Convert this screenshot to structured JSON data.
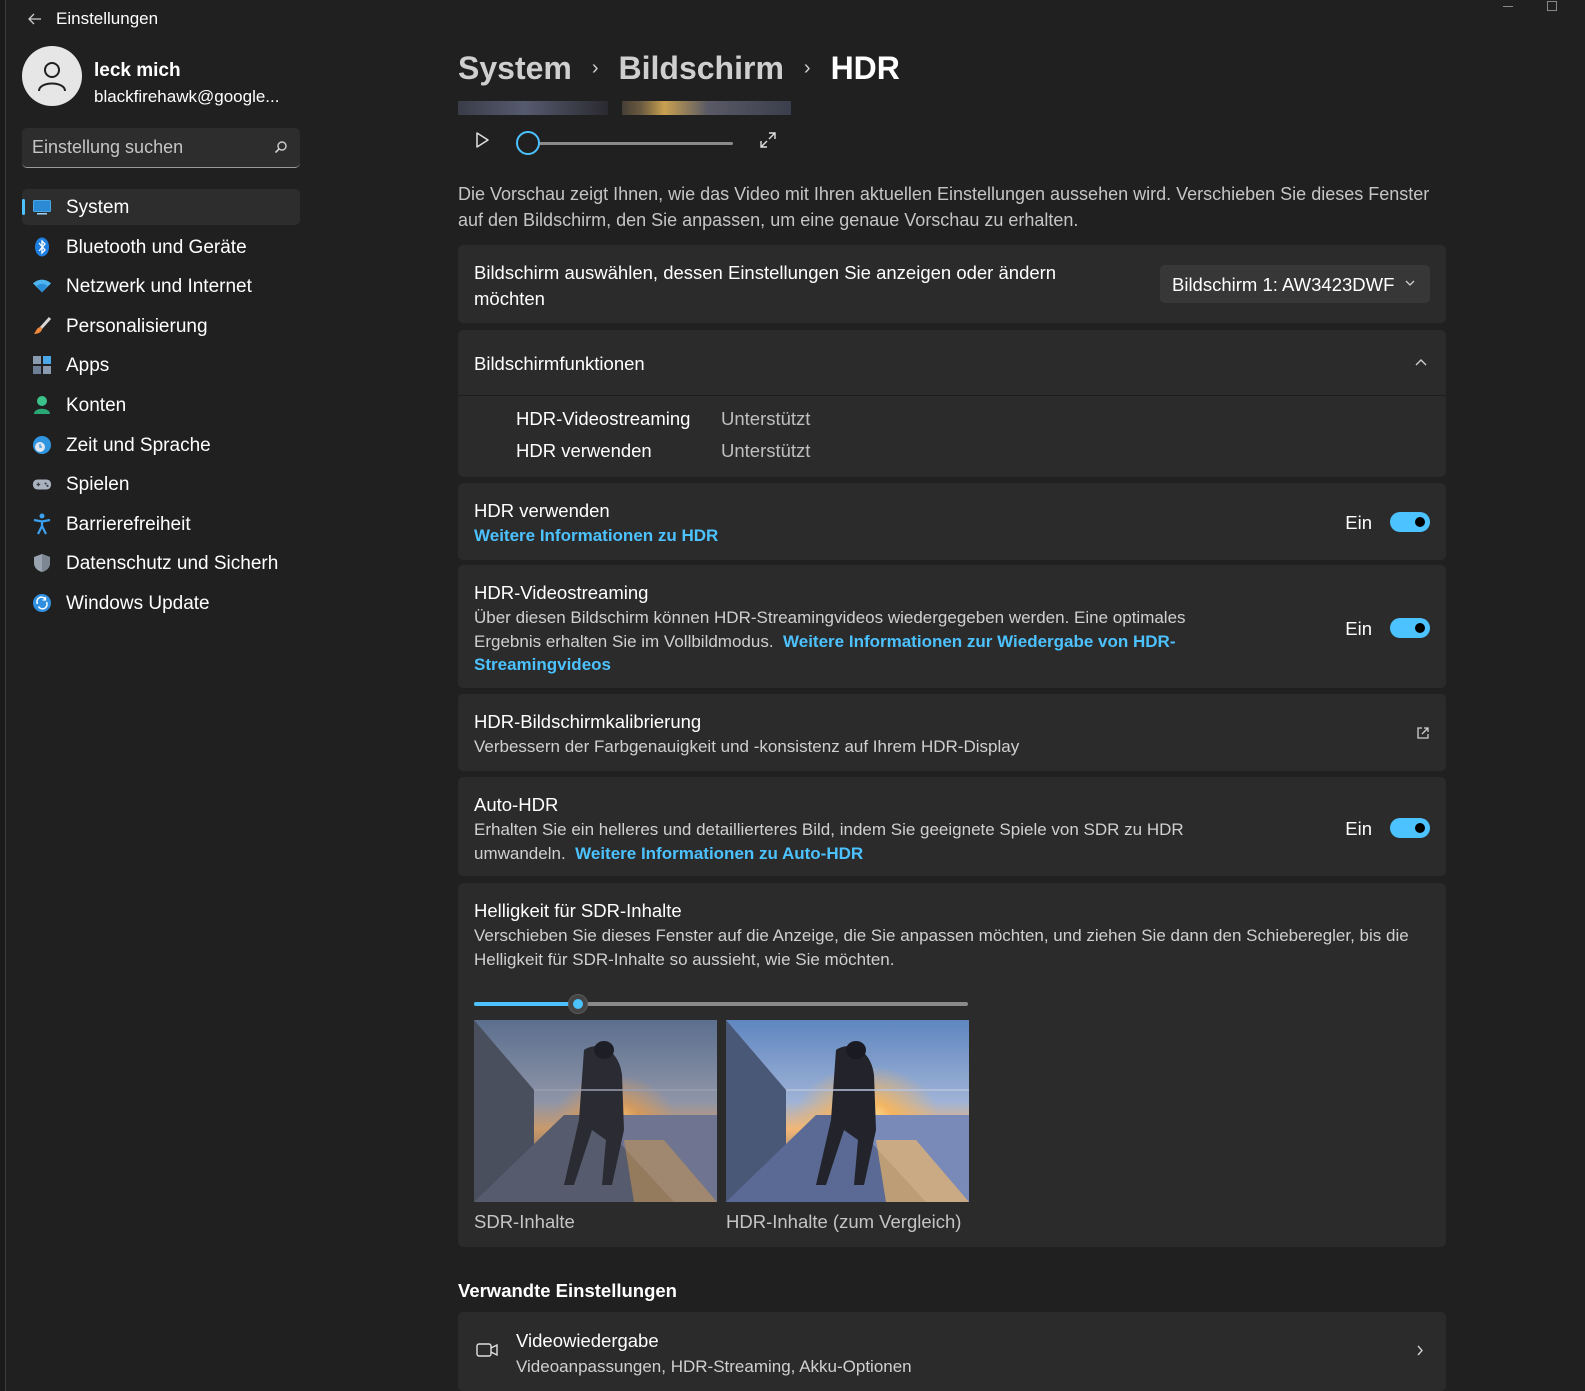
{
  "window": {
    "title": "Einstellungen"
  },
  "profile": {
    "name": "leck mich",
    "email": "blackfirehawk@google..."
  },
  "search": {
    "placeholder": "Einstellung suchen"
  },
  "nav": {
    "items": [
      {
        "label": "System",
        "icon": "system-icon",
        "active": true
      },
      {
        "label": "Bluetooth und Geräte",
        "icon": "bluetooth-icon"
      },
      {
        "label": "Netzwerk und Internet",
        "icon": "wifi-icon"
      },
      {
        "label": "Personalisierung",
        "icon": "brush-icon"
      },
      {
        "label": "Apps",
        "icon": "apps-icon"
      },
      {
        "label": "Konten",
        "icon": "account-icon"
      },
      {
        "label": "Zeit und Sprache",
        "icon": "globe-clock-icon"
      },
      {
        "label": "Spielen",
        "icon": "gamepad-icon"
      },
      {
        "label": "Barrierefreiheit",
        "icon": "accessibility-icon"
      },
      {
        "label": "Datenschutz und Sicherheit",
        "icon": "shield-icon"
      },
      {
        "label": "Windows Update",
        "icon": "update-icon"
      }
    ]
  },
  "breadcrumb": {
    "items": [
      "System",
      "Bildschirm"
    ],
    "current": "HDR"
  },
  "preview": {
    "description": "Die Vorschau zeigt Ihnen, wie das Video mit Ihren aktuellen Einstellungen aussehen wird. Verschieben Sie dieses Fenster auf den Bildschirm, den Sie anpassen, um eine genaue Vorschau zu erhalten."
  },
  "display_select": {
    "label": "Bildschirm auswählen, dessen Einstellungen Sie anzeigen oder ändern möchten",
    "value": "Bildschirm 1: AW3423DWF"
  },
  "features": {
    "title": "Bildschirmfunktionen",
    "rows": [
      {
        "name": "HDR-Videostreaming",
        "value": "Unterstützt"
      },
      {
        "name": "HDR verwenden",
        "value": "Unterstützt"
      }
    ]
  },
  "use_hdr": {
    "title": "HDR verwenden",
    "link": "Weitere Informationen zu HDR",
    "state": "Ein"
  },
  "hdr_streaming": {
    "title": "HDR-Videostreaming",
    "desc": "Über diesen Bildschirm können HDR-Streamingvideos wiedergegeben werden. Eine optimales Ergebnis erhalten Sie im Vollbildmodus.",
    "link": "Weitere Informationen zur Wiedergabe von HDR-Streamingvideos",
    "state": "Ein"
  },
  "calibration": {
    "title": "HDR-Bildschirmkalibrierung",
    "desc": "Verbessern der Farbgenauigkeit und -konsistenz auf Ihrem HDR-Display"
  },
  "auto_hdr": {
    "title": "Auto-HDR",
    "desc": "Erhalten Sie ein helleres und detaillierteres Bild, indem Sie geeignete Spiele von SDR zu HDR umwandeln.",
    "link": "Weitere Informationen zu Auto-HDR",
    "state": "Ein"
  },
  "sdr_brightness": {
    "title": "Helligkeit für SDR-Inhalte",
    "desc": "Verschieben Sie dieses Fenster auf die Anzeige, die Sie anpassen möchten, und ziehen Sie dann den Schieberegler, bis die Helligkeit für SDR-Inhalte so aussieht, wie Sie möchten.",
    "value_fraction": 0.21,
    "sdr_caption": "SDR-Inhalte",
    "hdr_caption": "HDR-Inhalte (zum Vergleich)"
  },
  "video_progress_fraction": 0.0,
  "related": {
    "heading": "Verwandte Einstellungen",
    "items": [
      {
        "title": "Videowiedergabe",
        "desc": "Videoanpassungen, HDR-Streaming, Akku-Optionen"
      }
    ]
  },
  "colors": {
    "accent": "#4cc2ff",
    "background": "#202020",
    "card": "#2b2b2b"
  }
}
